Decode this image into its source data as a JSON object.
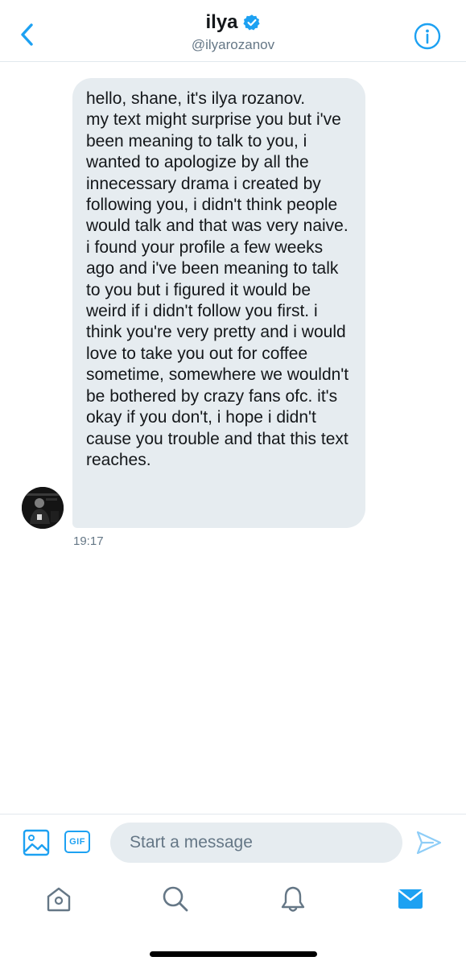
{
  "header": {
    "title": "ilya",
    "handle": "@ilyarozanov",
    "verified": true
  },
  "conversation": {
    "message": {
      "text": "hello, shane, it's ilya rozanov.\nmy text might surprise you but i've been meaning to talk to you, i wanted to apologize by all the innecessary drama i created by following you, i didn't think people would talk and that was very naive.\ni found your profile a few weeks ago and i've been meaning to talk to you but i figured it would be weird if i didn't follow you first. i think you're very pretty and i would love to take you out for coffee sometime, somewhere we wouldn't be bothered by crazy fans ofc. it's okay if you don't, i hope i didn't cause you trouble and that this text reaches.",
      "timestamp": "19:17"
    }
  },
  "composer": {
    "placeholder": "Start a message",
    "value": "",
    "gif_label": "GIF"
  },
  "icons": {
    "back": "chevron-left-icon",
    "info": "info-icon",
    "verified": "verified-badge-icon",
    "image": "image-icon",
    "send": "send-icon",
    "home": "home-icon",
    "search": "search-icon",
    "notifications": "bell-icon",
    "messages": "mail-icon"
  },
  "colors": {
    "accent": "#1da1f2",
    "bubble": "#e6ecf0",
    "text": "#14171a",
    "secondary": "#657786",
    "divider": "#e1e8ed"
  }
}
